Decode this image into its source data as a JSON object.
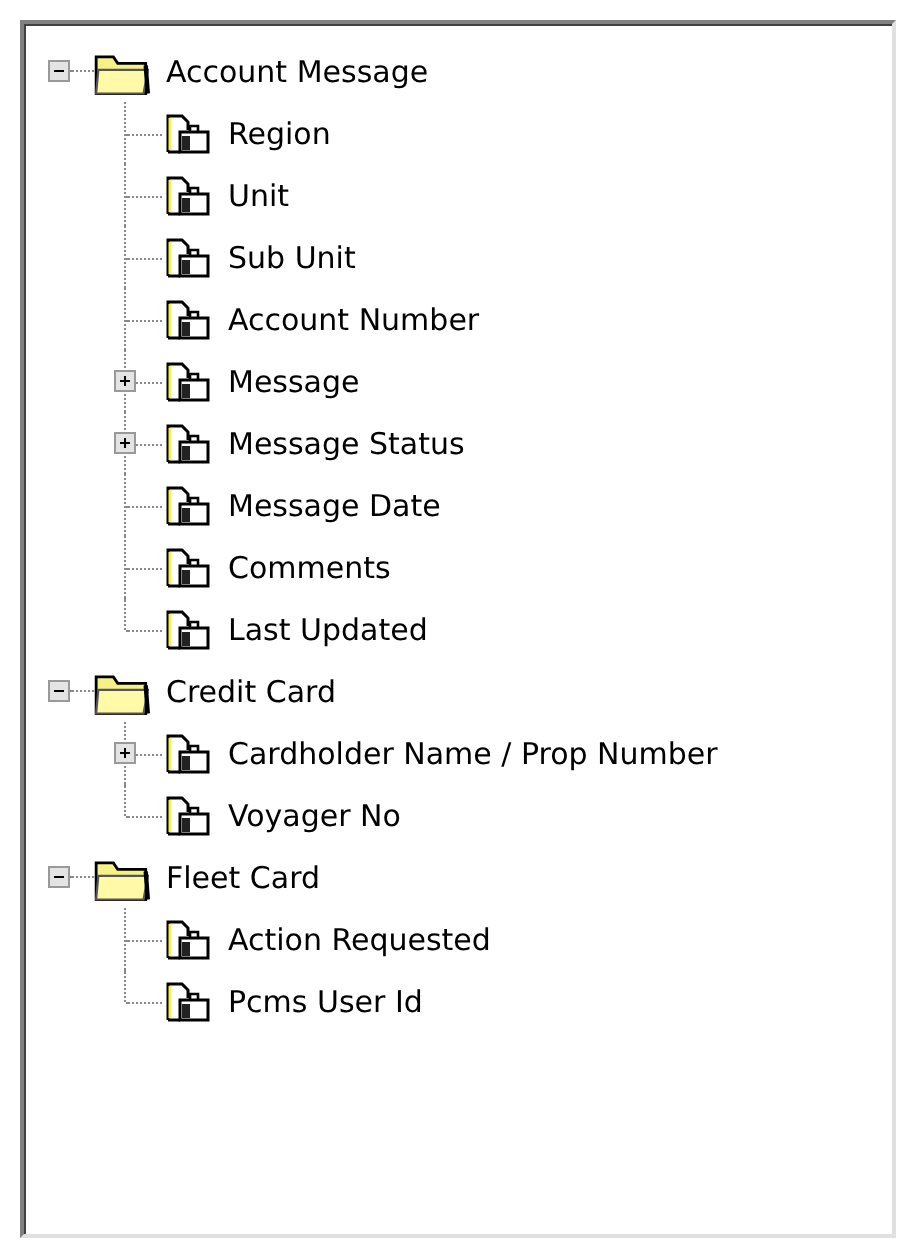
{
  "tree": [
    {
      "label": "Account Message",
      "kind": "folder",
      "expanded": true,
      "children": [
        {
          "label": "Region",
          "kind": "leaf"
        },
        {
          "label": "Unit",
          "kind": "leaf"
        },
        {
          "label": "Sub Unit",
          "kind": "leaf"
        },
        {
          "label": "Account Number",
          "kind": "leaf"
        },
        {
          "label": "Message",
          "kind": "branch",
          "expanded": false
        },
        {
          "label": "Message Status",
          "kind": "branch",
          "expanded": false
        },
        {
          "label": "Message Date",
          "kind": "leaf"
        },
        {
          "label": "Comments",
          "kind": "leaf"
        },
        {
          "label": "Last Updated",
          "kind": "leaf"
        }
      ]
    },
    {
      "label": "Credit Card",
      "kind": "folder",
      "expanded": true,
      "children": [
        {
          "label": "Cardholder Name / Prop Number",
          "kind": "branch",
          "expanded": false
        },
        {
          "label": "Voyager No",
          "kind": "leaf"
        }
      ]
    },
    {
      "label": "Fleet Card",
      "kind": "folder",
      "expanded": true,
      "children": [
        {
          "label": "Action Requested",
          "kind": "leaf"
        },
        {
          "label": "Pcms User Id",
          "kind": "leaf"
        }
      ]
    }
  ]
}
